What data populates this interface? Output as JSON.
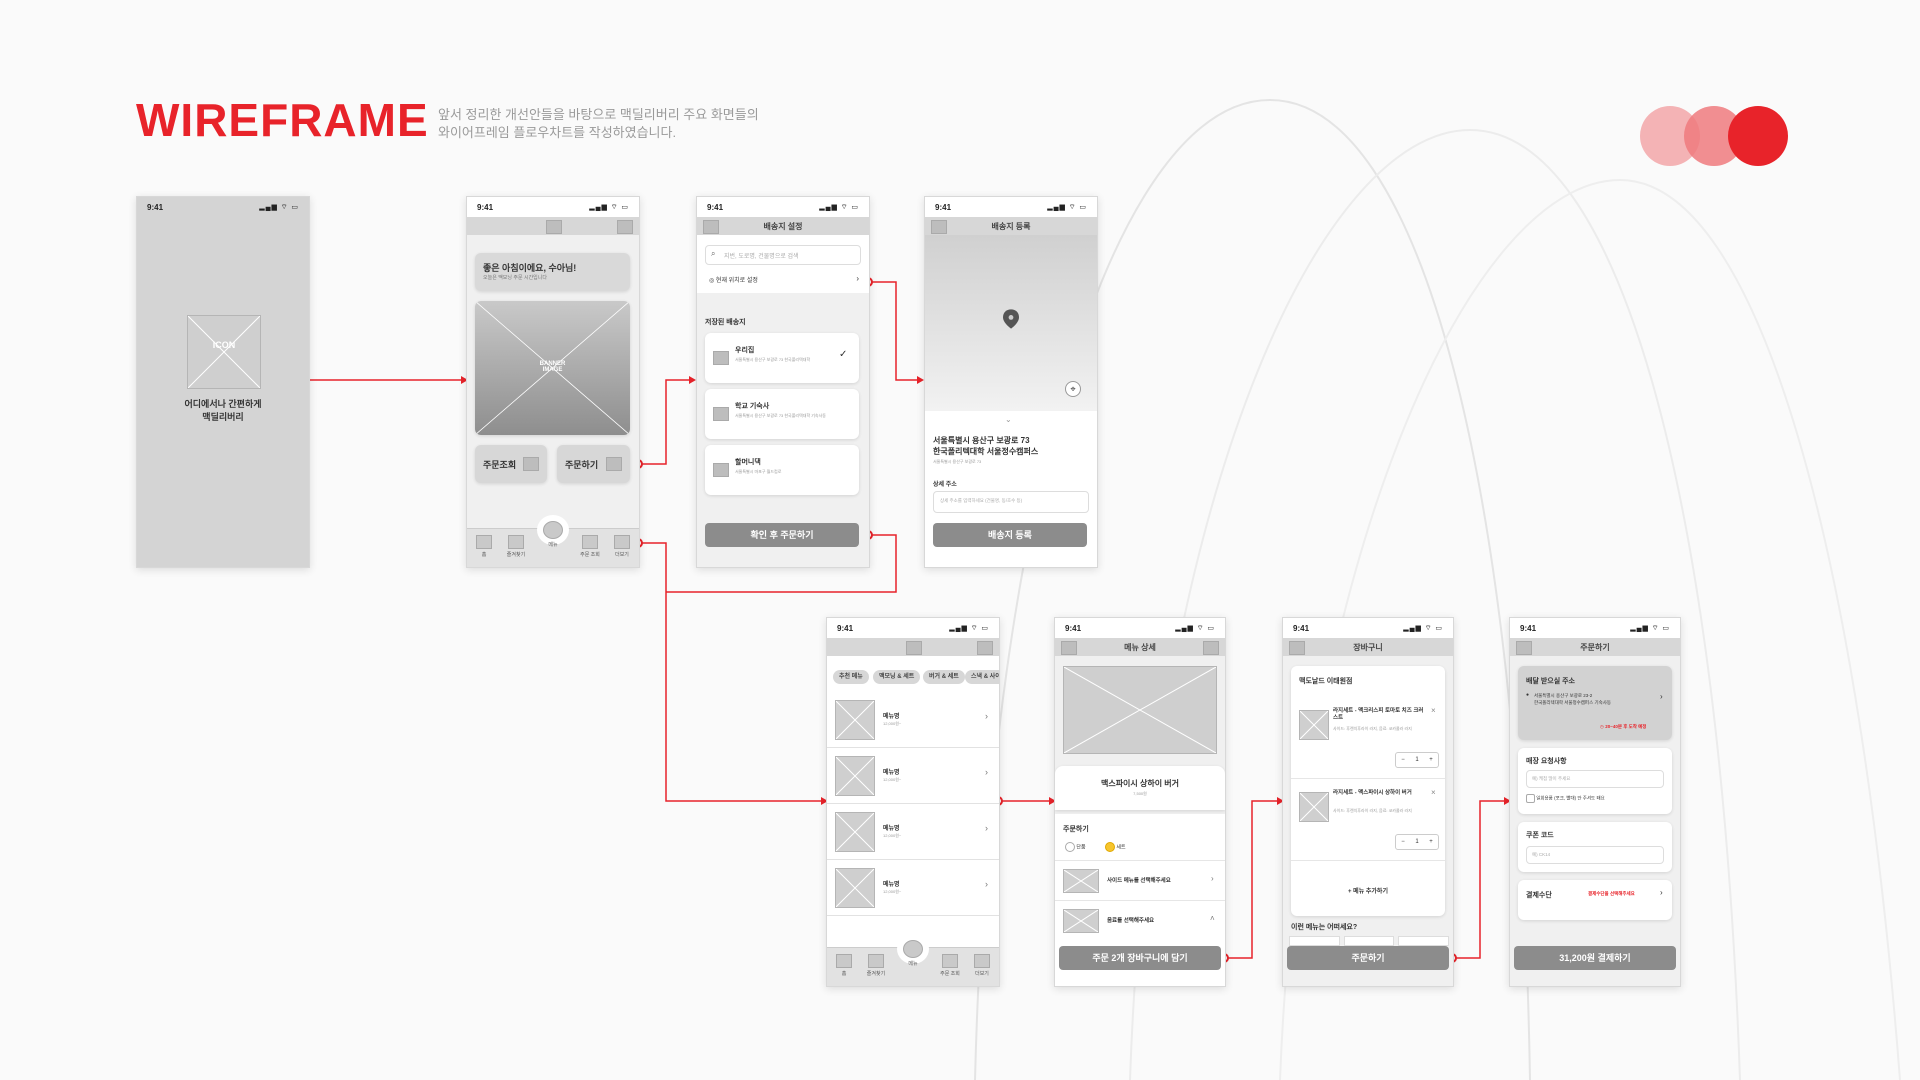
{
  "header": {
    "title": "WIREFRAME",
    "subtitle_line1": "앞서 정리한 개선안들을 바탕으로 맥딜리버리 주요 화면들의",
    "subtitle_line2": "와이어프레임 플로우차트를 작성하였습니다."
  },
  "colors": {
    "accent": "#e8232a",
    "accent_light": "#f4b3b5",
    "accent_mid": "#ee7a7e"
  },
  "common": {
    "time": "9:41",
    "icon": "ICON",
    "signal": "▂▄▆ ⌔ ▭"
  },
  "splash": {
    "icon_label": "ICON",
    "line1": "어디에서나 간편하게",
    "line2": "맥딜리버리"
  },
  "home": {
    "greeting": "좋은 아침이에요, 수아님!",
    "greeting_sub": "오늘은 맥모닝 주문 시간입니다",
    "banner": "BANNER IMAGE",
    "order_check": "주문조회",
    "order": "주문하기",
    "tabs": [
      "홈",
      "즐겨찾기",
      "메뉴",
      "주문 조회",
      "더보기"
    ]
  },
  "address": {
    "title": "배송지 설정",
    "search_placeholder": "지번, 도로명, 건물명으로 검색",
    "current_location": "현재 위치로 설정",
    "saved_title": "저장된 배송지",
    "items": [
      {
        "name": "우리집",
        "detail": "서울특별시 용산구 보광로 73 한국폴리텍대학"
      },
      {
        "name": "학교 기숙사",
        "detail": "서울특별시 용산구 보광로 73 한국폴리텍대학 기숙사동"
      },
      {
        "name": "할머니댁",
        "detail": "서울특별시 마포구 월드컵로"
      }
    ],
    "confirm_button": "확인 후 주문하기"
  },
  "register": {
    "title": "배송지 등록",
    "addr_line1": "서울특별시 용산구 보광로 73",
    "addr_line2": "한국폴리텍대학 서울정수캠퍼스",
    "addr_sub": "서울특별시 용산구 보광로 73",
    "detail_label": "상세 주소",
    "detail_placeholder": "상세 주소를 입력하세요 (건물명, 동/호수 등)",
    "button": "배송지 등록"
  },
  "menu_list": {
    "chips": [
      "추천 메뉴",
      "맥모닝 & 세트",
      "버거 & 세트",
      "스낵 & 사이"
    ],
    "items": [
      {
        "name": "메뉴명",
        "price": "12,000원~"
      },
      {
        "name": "메뉴명",
        "price": "12,000원~"
      },
      {
        "name": "메뉴명",
        "price": "12,000원~"
      },
      {
        "name": "메뉴명",
        "price": "12,000원~"
      }
    ],
    "tabs": [
      "홈",
      "즐겨찾기",
      "메뉴",
      "주문 조회",
      "더보기"
    ]
  },
  "menu_detail": {
    "title": "메뉴 상세",
    "name": "맥스파이시 상하이 버거",
    "price": "7,500원",
    "order_label": "주문하기",
    "options": [
      "단품",
      "세트"
    ],
    "side_menu": "사이드 메뉴를 선택해주세요",
    "drink_menu": "음료를 선택해주세요",
    "button": "주문 2개 장바구니에 담기"
  },
  "cart": {
    "title": "장바구니",
    "store": "맥도날드 이태원점",
    "item1_name": "라지세트 - 맥크리스피 토마토 치즈 크러스트",
    "item1_detail": "사이드: 후렌치후라이 라지, 음료: 코카콜라 라지",
    "item2_name": "라지세트 - 맥스파이시 상하이 버거",
    "item2_detail": "사이드: 후렌치후라이 라지, 음료: 코카콜라 라지",
    "qty": "1",
    "add_menu": "+ 메뉴 추가하기",
    "recommend": "이런 메뉴는 어떠세요?",
    "button": "주문하기"
  },
  "checkout": {
    "title": "주문하기",
    "addr_label": "배달 받으실 주소",
    "addr_line1": "서울특별시 용산구 보광로 23-2",
    "addr_line2": "한국폴리텍대학 서울정수캠퍼스 기숙사동",
    "eta": "20~40분 후 도착 예정",
    "request_label": "매장 요청사항",
    "request_placeholder": "예) 케첩 많이 주세요",
    "disposable": "일회용품 (포크, 빨대) 안 주셔도 돼요",
    "coupon_label": "쿠폰 코드",
    "coupon_placeholder": "예) CK14",
    "pay_label": "결제수단",
    "pay_link": "결제수단을 선택해주세요",
    "button": "31,200원 결제하기"
  }
}
